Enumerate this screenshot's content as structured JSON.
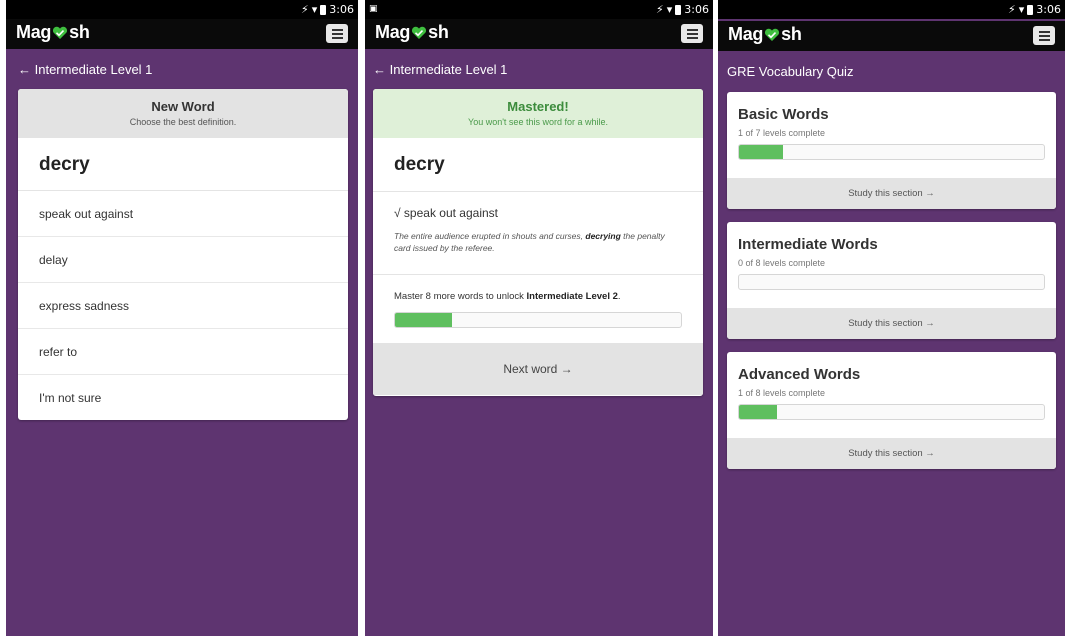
{
  "status": {
    "time": "3:06"
  },
  "brand": {
    "name_start": "Mag",
    "name_end": "sh",
    "accent": "#3fbf3f"
  },
  "colors": {
    "purple": "#5e3470",
    "progress": "#5fbf5f"
  },
  "screen1": {
    "back": "← Intermediate Level 1",
    "card_title": "New Word",
    "card_subtitle": "Choose the best definition.",
    "word": "decry",
    "options": [
      "speak out against",
      "delay",
      "express sadness",
      "refer to",
      "I'm not sure"
    ]
  },
  "screen2": {
    "back": "← Intermediate Level 1",
    "card_title": "Mastered!",
    "card_subtitle": "You won't see this word for a while.",
    "word": "decry",
    "answer": "√ speak out against",
    "example_pre": "The entire audience erupted in shouts and curses, ",
    "example_bold": "decrying",
    "example_post": " the penalty card issued by the referee.",
    "unlock_pre": "Master 8 more words to unlock ",
    "unlock_bold": "Intermediate Level 2",
    "unlock_post": ".",
    "progress": 0.2,
    "next": "Next word →"
  },
  "screen3": {
    "title": "GRE Vocabulary Quiz",
    "sections": [
      {
        "name": "Basic Words",
        "sub": "1 of 7 levels complete",
        "progress": 0.143,
        "action": "Study this section →"
      },
      {
        "name": "Intermediate Words",
        "sub": "0 of 8 levels complete",
        "progress": 0,
        "action": "Study this section →"
      },
      {
        "name": "Advanced Words",
        "sub": "1 of 8 levels complete",
        "progress": 0.125,
        "action": "Study this section →"
      }
    ]
  }
}
